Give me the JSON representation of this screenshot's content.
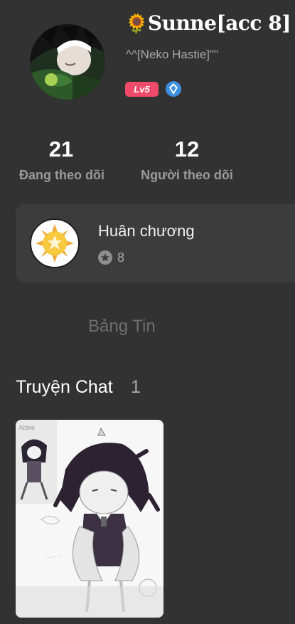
{
  "profile": {
    "name_icon": "sunflower-icon",
    "name": "Sunne[acc 8]",
    "subtitle": "^^[Neko Hastie]\"\"",
    "level": "Lv5",
    "leader_icon": "blue-shield-icon"
  },
  "stats": [
    {
      "value": "21",
      "label": "Đang theo dõi"
    },
    {
      "value": "12",
      "label": "Người theo dõi"
    }
  ],
  "badges_card": {
    "title": "Huân chương",
    "count": "8",
    "medal_icon": "sun-medal-icon"
  },
  "tabs": {
    "feed": "Bảng Tin"
  },
  "chat_section": {
    "title": "Truyện Chat",
    "count": "1",
    "thumbnail_caption": "Abbie"
  },
  "colors": {
    "background": "#323232",
    "card": "#3c3c3c",
    "level_badge": "#ef4a69",
    "leader_badge": "#3d8fe0"
  }
}
